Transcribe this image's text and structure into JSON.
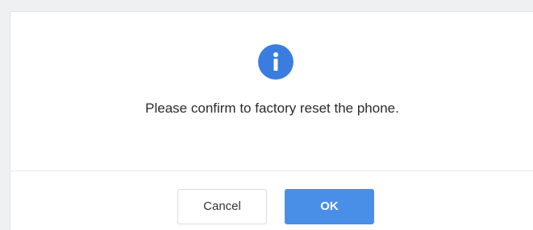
{
  "dialog": {
    "icon": "info-icon",
    "message": "Please confirm to factory reset the phone.",
    "cancel_label": "Cancel",
    "ok_label": "OK"
  },
  "colors": {
    "accent": "#4a8fe7",
    "info_icon": "#3a7de0",
    "text": "#2b2b2b"
  }
}
